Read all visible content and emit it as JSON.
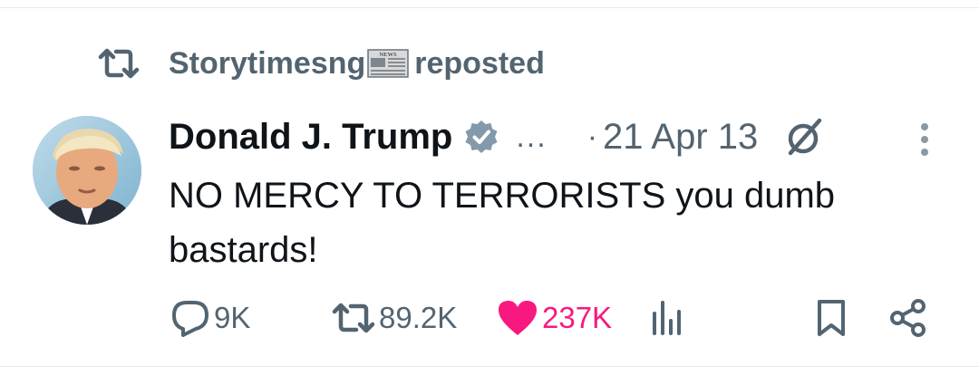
{
  "repost": {
    "user": "Storytimesng",
    "news_emoji_label": "NEWS",
    "suffix": "reposted"
  },
  "tweet": {
    "author": "Donald J. Trump",
    "handle_truncated": "...",
    "separator": "·",
    "timestamp": "21 Apr 13",
    "text": "NO MERCY TO TERRORISTS you dumb bastards!"
  },
  "actions": {
    "replies": "9K",
    "reposts": "89.2K",
    "likes": "237K"
  },
  "colors": {
    "muted": "#536471",
    "text": "#0f1419",
    "like": "#f91880",
    "verified": "#829aab"
  },
  "icons": {
    "repost": "repost-icon",
    "verified": "verified-badge-icon",
    "grok": "grok-icon",
    "more": "more-icon",
    "reply": "reply-icon",
    "retweet": "retweet-icon",
    "like": "heart-icon",
    "views": "views-icon",
    "bookmark": "bookmark-icon",
    "share": "share-icon"
  }
}
